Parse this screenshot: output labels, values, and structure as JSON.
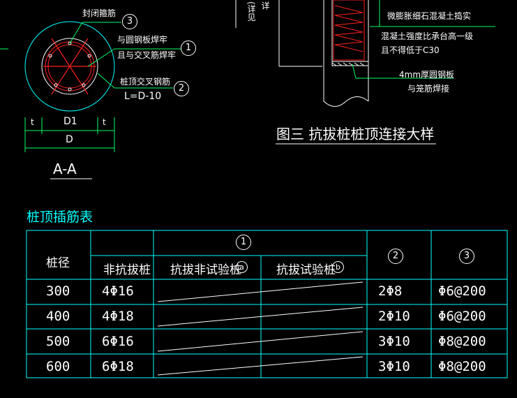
{
  "colors": {
    "background": "#000000",
    "text": "#ffffff",
    "table_lines": "#00ffff",
    "green_lines": "#00ff66",
    "rebar_red": "#ff2020",
    "title_cyan": "#00ffff"
  },
  "section_aa": {
    "label_closure_hoop": "封闭箍筋",
    "label_weld_1": "与圆钢板焊牢",
    "label_weld_2": "且与交叉筋焊牢",
    "label_cross_bar": "桩顶交叉钢筋",
    "label_length": "L=D-10",
    "marker_1": "1",
    "marker_2": "2",
    "marker_3": "3",
    "dim_t_left": "t",
    "dim_t_right": "t",
    "dim_d1": "D1",
    "dim_d": "D",
    "section_title": "A-A"
  },
  "detail_3": {
    "vertical_note": "(详见",
    "vertical_note_2": "详",
    "note_concrete_1": "微膨胀细石混凝土捣实",
    "note_concrete_2": "混凝土强度比承台高一级",
    "note_concrete_3": "且不得低于C30",
    "note_plate_1": "4mm厚圆钢板",
    "note_plate_2": "与笼筋焊接",
    "figure_title": "图三  抗拔桩桩顶连接大样"
  },
  "table": {
    "title": "桩顶插筋表",
    "col_pile_dia": "桩径",
    "group_1": "1",
    "col_non_uplift": "非抗拔桩",
    "col_uplift_nontest": "抗拔非试验桩",
    "col_uplift_nontest_mark": "a",
    "col_uplift_test": "抗拔试验桩",
    "col_uplift_test_mark": "b",
    "col_2": "2",
    "col_3": "3",
    "rows": [
      {
        "dia": "300",
        "non_uplift": "4Φ16",
        "c2": "2Φ8",
        "c3": "Φ6@200"
      },
      {
        "dia": "400",
        "non_uplift": "4Φ18",
        "c2": "2Φ10",
        "c3": "Φ6@200"
      },
      {
        "dia": "500",
        "non_uplift": "6Φ16",
        "c2": "3Φ10",
        "c3": "Φ8@200"
      },
      {
        "dia": "600",
        "non_uplift": "6Φ18",
        "c2": "3Φ10",
        "c3": "Φ8@200"
      }
    ]
  }
}
